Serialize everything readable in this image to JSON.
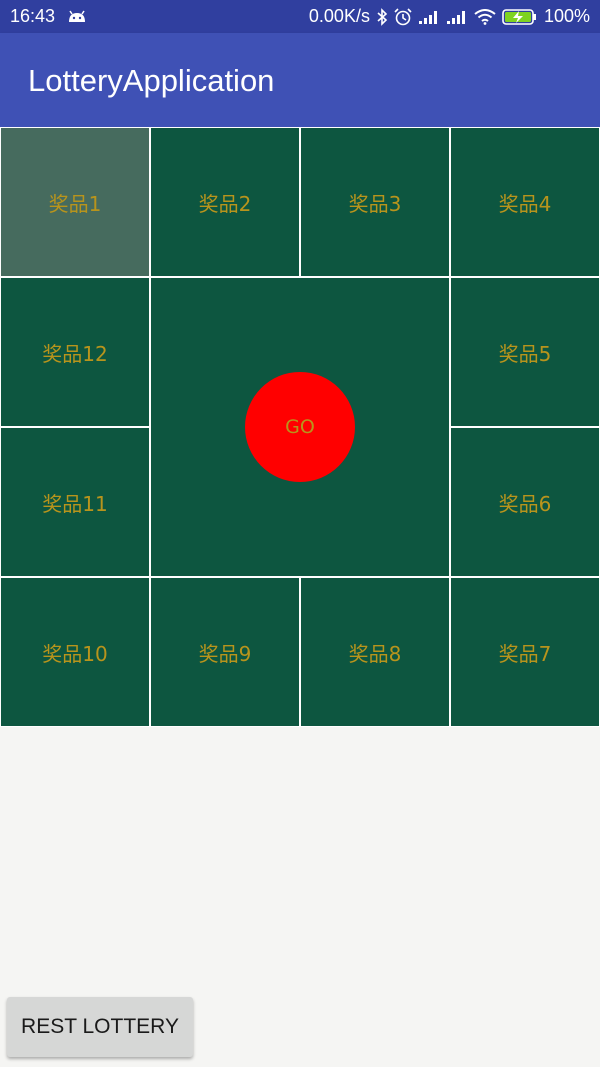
{
  "status_bar": {
    "time": "16:43",
    "network_speed": "0.00K/s",
    "battery_percent": "100%",
    "icons": [
      "notification-icon",
      "bluetooth-icon",
      "alarm-icon",
      "signal-icon",
      "signal-icon",
      "wifi-icon",
      "battery-charging-icon"
    ]
  },
  "app_bar": {
    "title": "LotteryApplication"
  },
  "colors": {
    "primary": "#3f51b5",
    "primary_dark": "#303f9f",
    "cell_bg": "#0d5640",
    "cell_active_bg": "#466b5e",
    "prize_text": "#b8941c",
    "go_button": "#ff0000"
  },
  "lottery": {
    "active_prize": "奖品1",
    "prizes": {
      "p1": "奖品1",
      "p2": "奖品2",
      "p3": "奖品3",
      "p4": "奖品4",
      "p5": "奖品5",
      "p6": "奖品6",
      "p7": "奖品7",
      "p8": "奖品8",
      "p9": "奖品9",
      "p10": "奖品10",
      "p11": "奖品11",
      "p12": "奖品12"
    },
    "go_label": "GO"
  },
  "footer": {
    "reset_label": "REST LOTTERY"
  }
}
